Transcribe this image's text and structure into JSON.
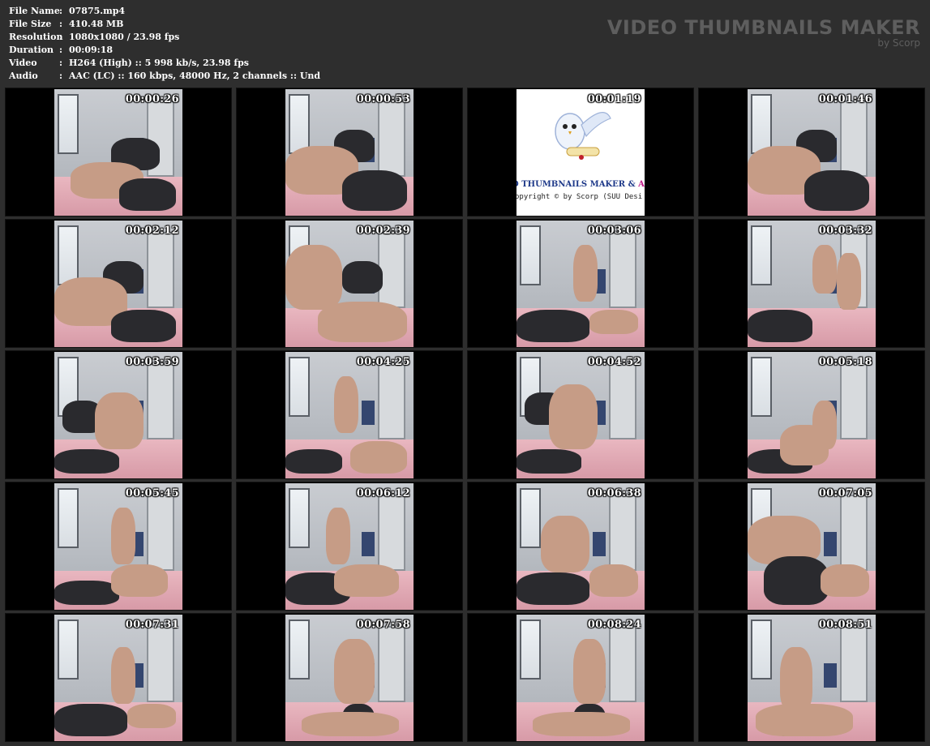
{
  "info": [
    {
      "label": "File Name",
      "sep": ":",
      "value": "07875.mp4"
    },
    {
      "label": "File Size",
      "sep": ":",
      "value": "410.48 MB"
    },
    {
      "label": "Resolution",
      "sep": ":",
      "value": "1080x1080 / 23.98 fps"
    },
    {
      "label": "Duration",
      "sep": ":",
      "value": "00:09:18"
    },
    {
      "label": "Video",
      "sep": ":",
      "value": "H264 (High) :: 5 998 kb/s, 23.98 fps"
    },
    {
      "label": "Audio",
      "sep": ":",
      "value": "AAC (LC) :: 160 kbps, 48000 Hz, 2 channels :: Und"
    }
  ],
  "brand": {
    "title": "VIDEO THUMBNAILS MAKER",
    "subtitle": "by Scorp"
  },
  "logo": {
    "text_main": "O THUMBNAILS MAKER & ",
    "text_accent": "ANIM",
    "copyright": "opyright © by Scorp (SUU Desi"
  },
  "thumbnails": [
    {
      "time": "00:00:26"
    },
    {
      "time": "00:00:53"
    },
    {
      "time": "00:01:19"
    },
    {
      "time": "00:01:46"
    },
    {
      "time": "00:02:12"
    },
    {
      "time": "00:02:39"
    },
    {
      "time": "00:03:06"
    },
    {
      "time": "00:03:32"
    },
    {
      "time": "00:03:59"
    },
    {
      "time": "00:04:25"
    },
    {
      "time": "00:04:52"
    },
    {
      "time": "00:05:18"
    },
    {
      "time": "00:05:45"
    },
    {
      "time": "00:06:12"
    },
    {
      "time": "00:06:38"
    },
    {
      "time": "00:07:05"
    },
    {
      "time": "00:07:31"
    },
    {
      "time": "00:07:58"
    },
    {
      "time": "00:08:24"
    },
    {
      "time": "00:08:51"
    }
  ]
}
